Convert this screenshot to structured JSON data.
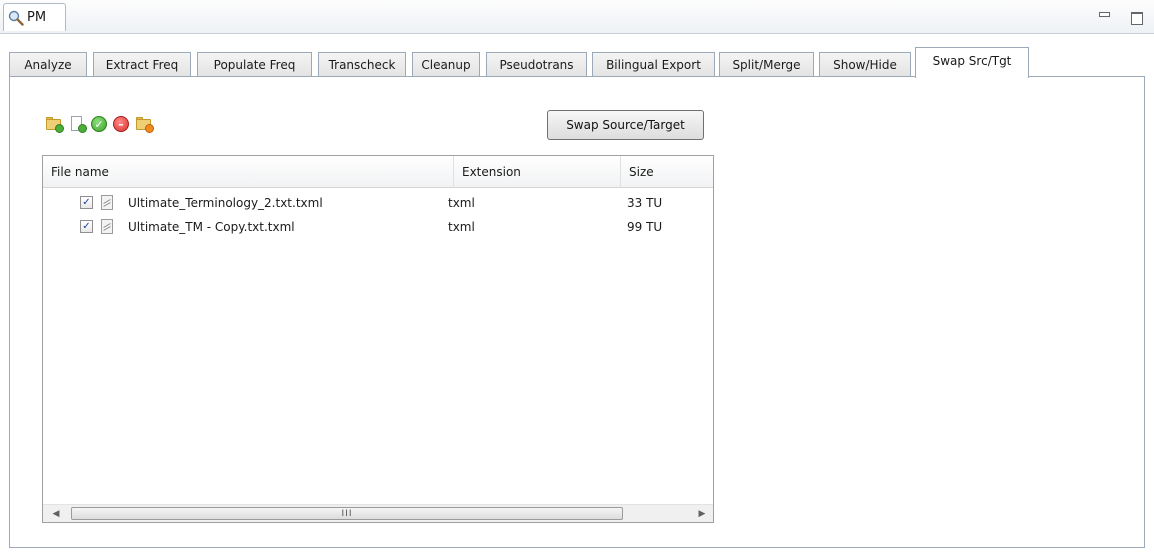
{
  "view": {
    "title": "PM",
    "icon": "magnifier-icon"
  },
  "tabs": [
    {
      "label": "Analyze"
    },
    {
      "label": "Extract Freq"
    },
    {
      "label": "Populate Freq"
    },
    {
      "label": "Transcheck"
    },
    {
      "label": "Cleanup"
    },
    {
      "label": "Pseudotrans"
    },
    {
      "label": "Bilingual Export"
    },
    {
      "label": "Split/Merge"
    },
    {
      "label": "Show/Hide"
    },
    {
      "label": "Swap Src/Tgt",
      "active": true
    }
  ],
  "toolbar": {
    "icons": [
      "add-folder-icon",
      "add-file-icon",
      "check-all-icon",
      "uncheck-all-icon",
      "remove-folder-icon"
    ],
    "swap_button_label": "Swap Source/Target"
  },
  "table": {
    "columns": [
      "File name",
      "Extension",
      "Size"
    ],
    "rows": [
      {
        "checked": true,
        "name": "Ultimate_Terminology_2.txt.txml",
        "extension": "txml",
        "size": "33 TU"
      },
      {
        "checked": true,
        "name": "Ultimate_TM - Copy.txt.txml",
        "extension": "txml",
        "size": "99 TU"
      }
    ],
    "scroll_thumb_grip": "III"
  }
}
